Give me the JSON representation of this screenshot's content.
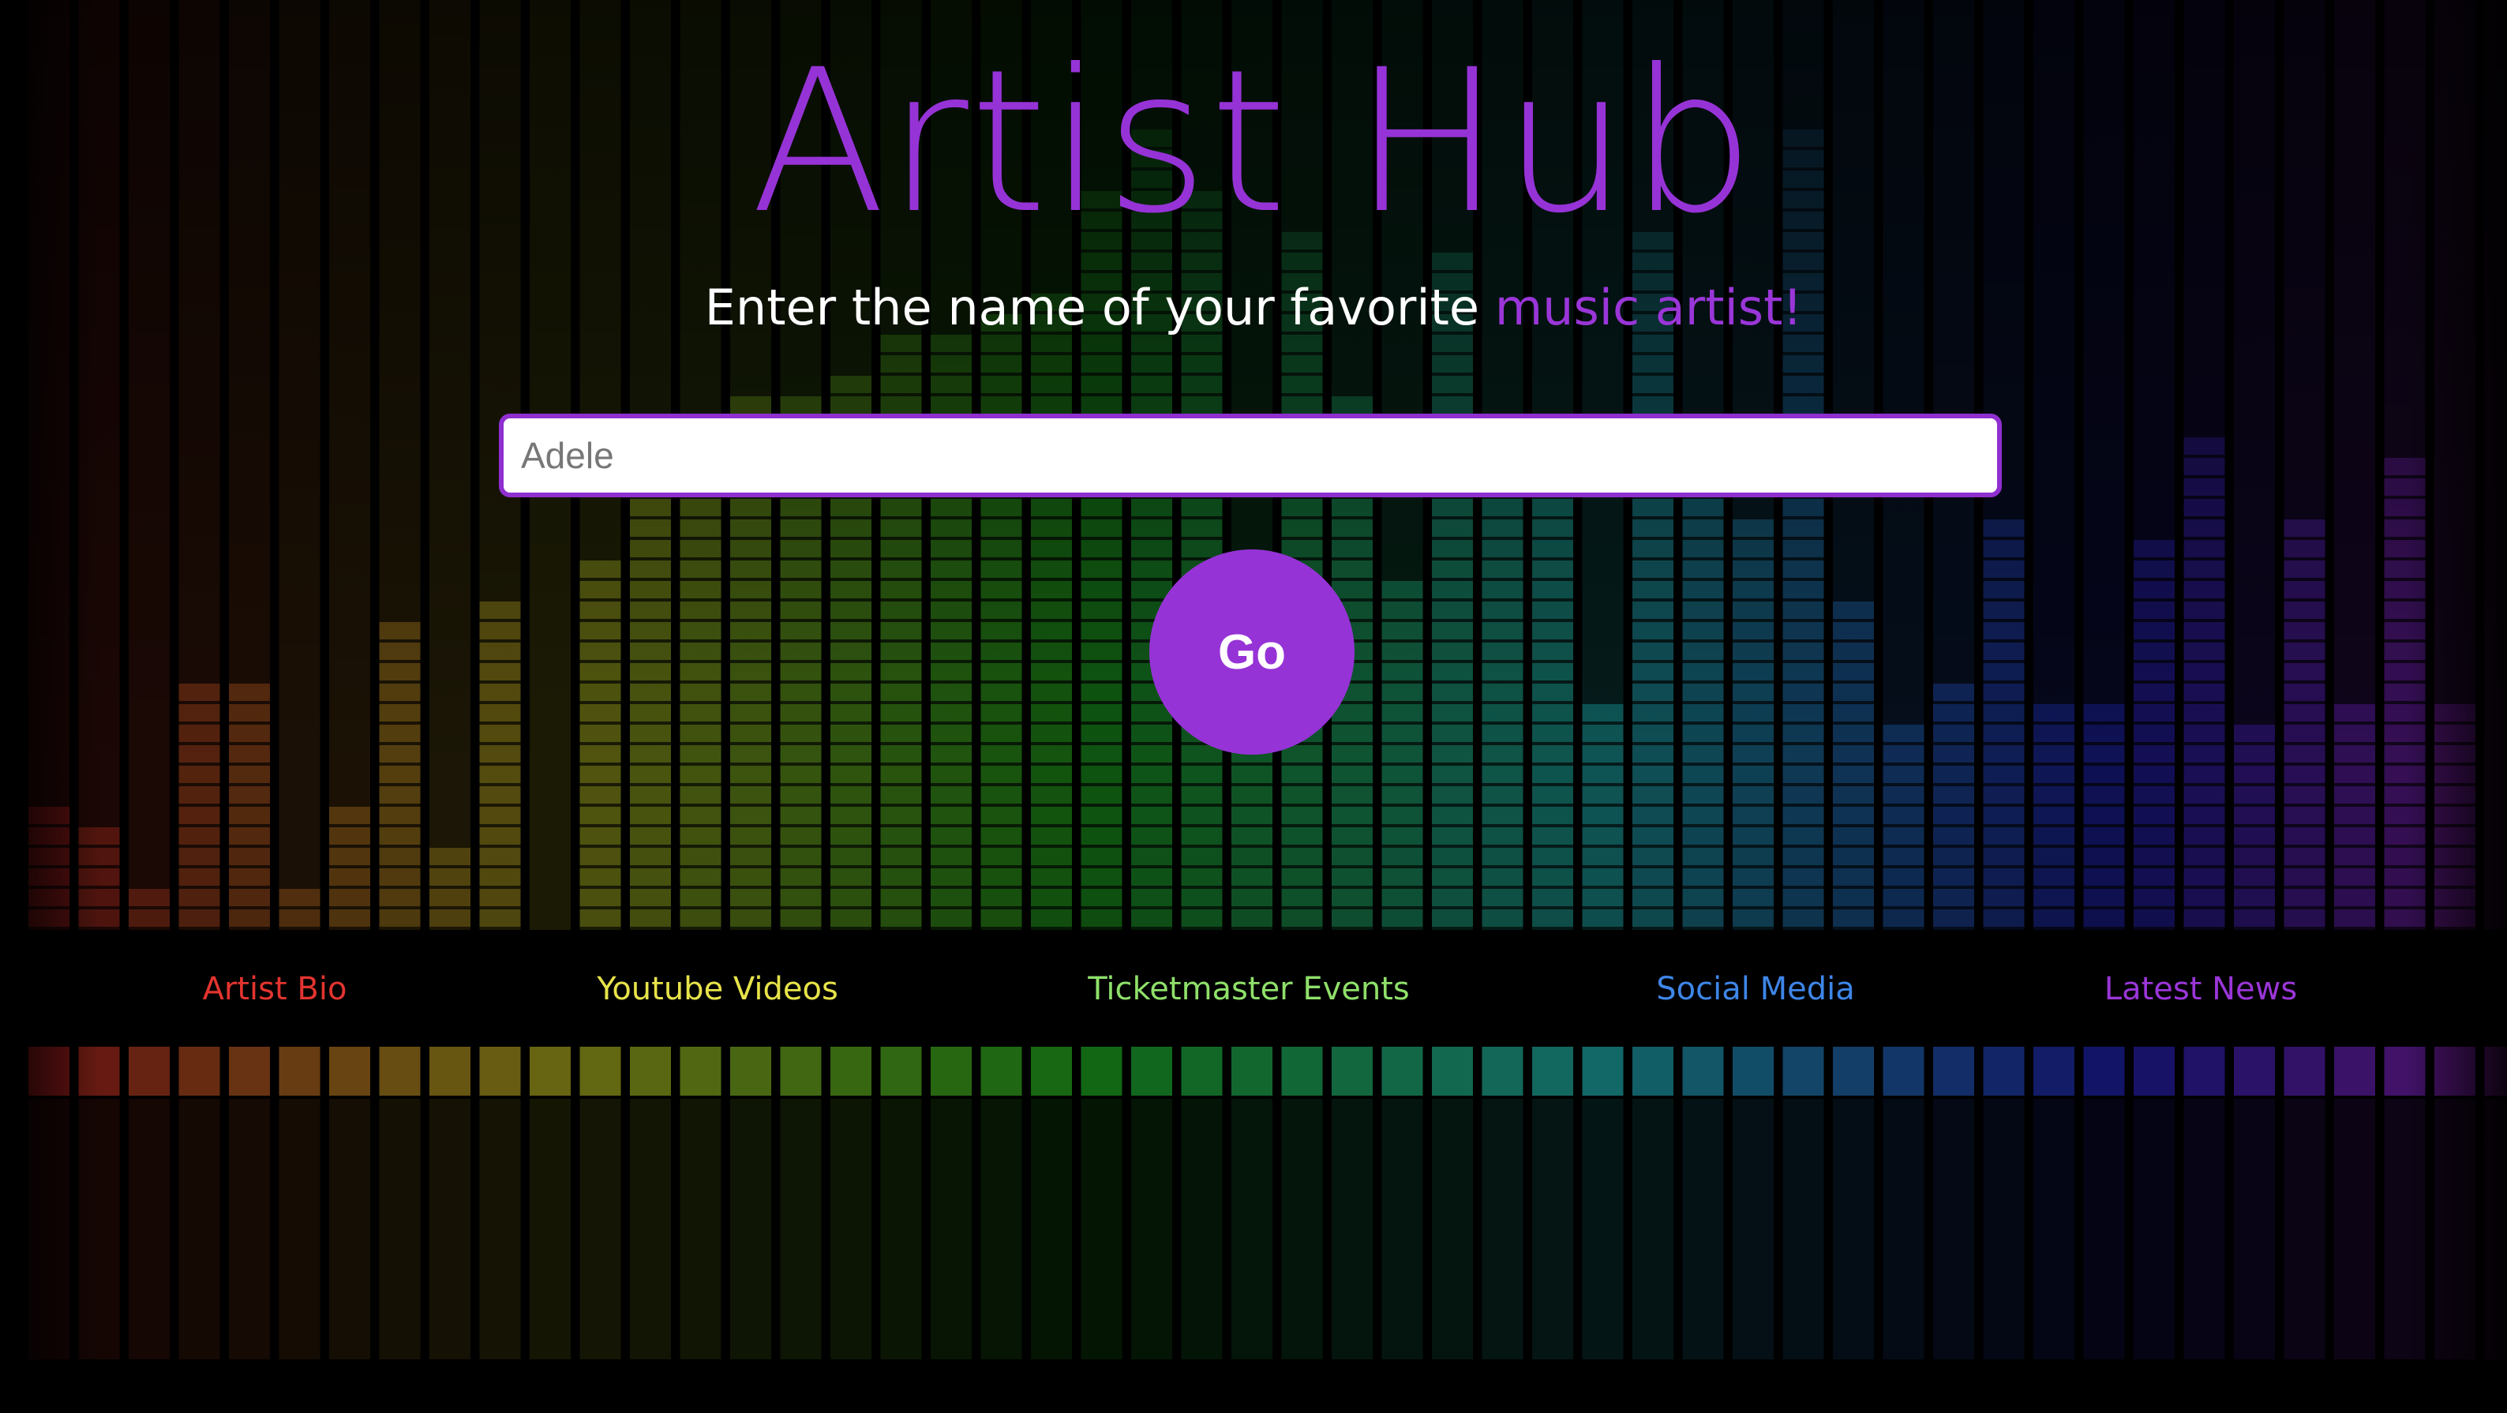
{
  "app": {
    "title": "Artist Hub"
  },
  "hero": {
    "subtitle_prefix": "Enter the name of your favorite ",
    "subtitle_accent": "music artist!"
  },
  "search": {
    "placeholder": "Adele",
    "value": ""
  },
  "go_button": {
    "label": "Go"
  },
  "nav": {
    "items": [
      {
        "label": "Artist Bio",
        "color": "#e3342f"
      },
      {
        "label": "Youtube Videos",
        "color": "#e7e34a"
      },
      {
        "label": "Ticketmaster Events",
        "color": "#8fe06a"
      },
      {
        "label": "Social Media",
        "color": "#3e86e8"
      },
      {
        "label": "Latest News",
        "color": "#9a36d8"
      }
    ]
  },
  "colors": {
    "accent": "#9633d6",
    "background": "#000000"
  },
  "background": {
    "description_icon": "equalizer-background"
  }
}
